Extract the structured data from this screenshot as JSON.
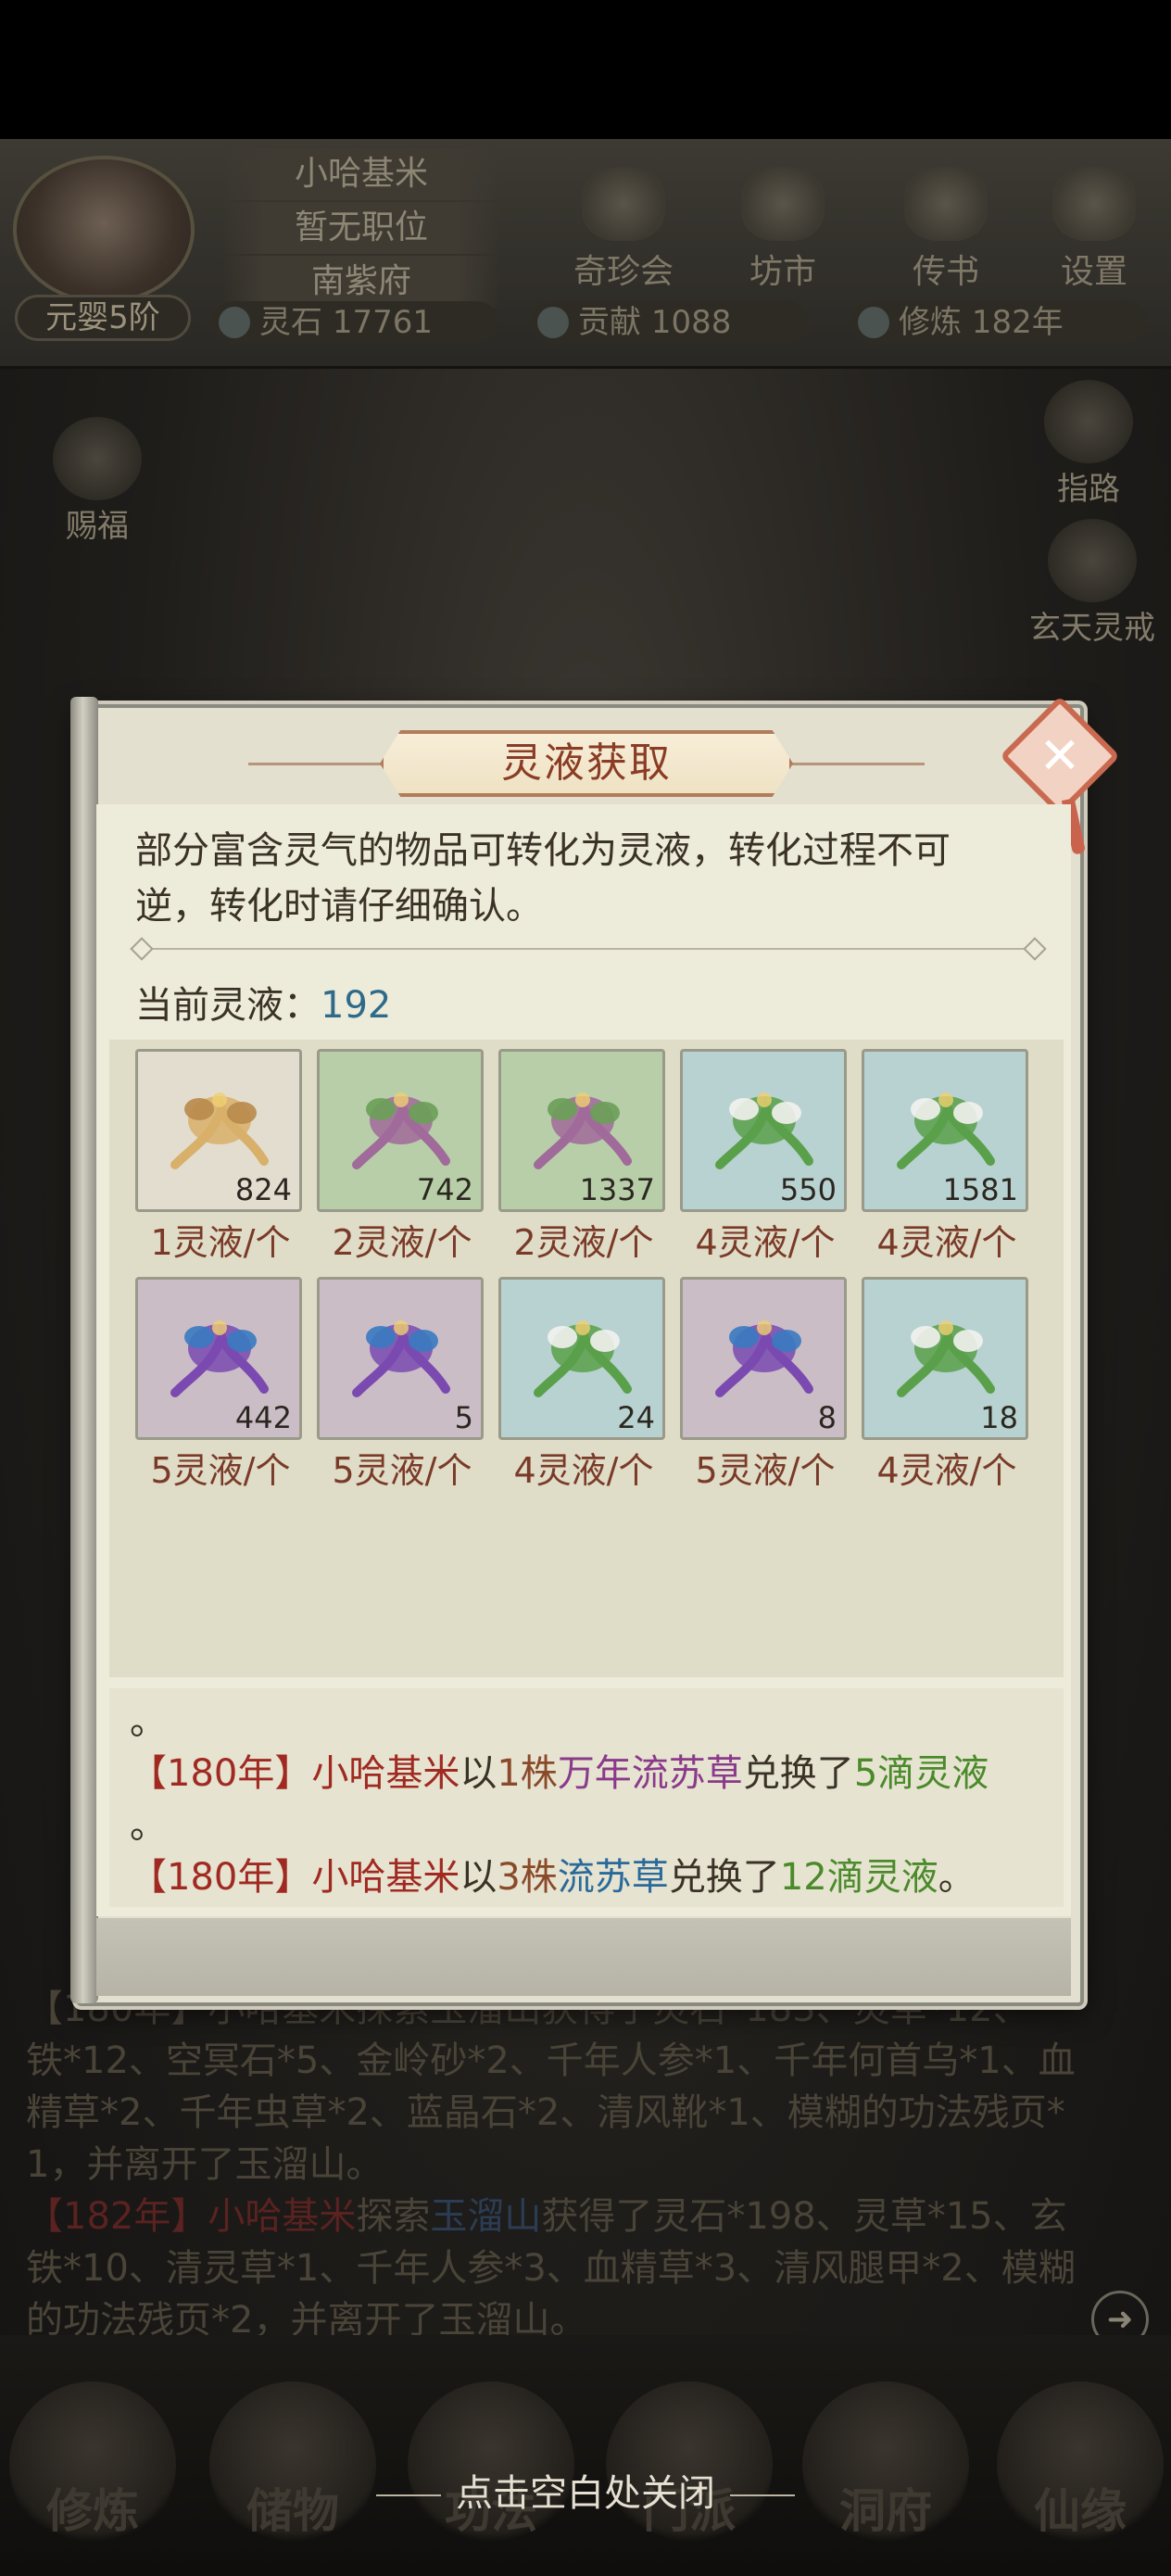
{
  "player": {
    "name": "小哈基米",
    "job": "暂无职位",
    "sect": "南紫府",
    "realm": "元婴5阶"
  },
  "top_buttons": [
    "奇珍会",
    "坊市",
    "传书",
    "设置"
  ],
  "resources": [
    {
      "label": "灵石",
      "value": "17761"
    },
    {
      "label": "贡献",
      "value": "1088"
    },
    {
      "label": "修炼",
      "value": "182年"
    }
  ],
  "side_icons": {
    "left": "赐福",
    "right_top": "指路",
    "right_bottom": "玄天灵戒"
  },
  "background_log": {
    "line1_prefix": "【180年】小哈基米探索玉溜山获得了灵石*183、灵草*12、",
    "line2": "铁*12、空冥石*5、金岭砂*2、千年人参*1、千年何首乌*1、血",
    "line3": "精草*2、千年虫草*2、蓝晶石*2、清风靴*1、模糊的功法残页*",
    "line4": "1，并离开了玉溜山。",
    "line5_year": "【182年】",
    "line5_name": "小哈基米",
    "line5_mid": "探索",
    "line5_place": "玉溜山",
    "line5_rest": "获得了灵石*198、灵草*15、玄",
    "line6": "铁*10、清灵草*1、千年人参*3、血精草*3、清风腿甲*2、模糊",
    "line7": "的功法残页*2，并离开了玉溜山。"
  },
  "bottom_nav": [
    "修炼",
    "储物",
    "功法",
    "门派",
    "洞府",
    "仙缘"
  ],
  "close_hint": "点击空白处关闭",
  "dialog": {
    "title": "灵液获取",
    "description_line1": "部分富含灵气的物品可转化为灵液，转化过程不可",
    "description_line2": "逆，转化时请仔细确认。",
    "current_label": "当前灵液：",
    "current_value": "192",
    "items": [
      {
        "count": "824",
        "rate": "1灵液/个",
        "rarity": "white",
        "icon": "ginseng-icon"
      },
      {
        "count": "742",
        "rate": "2灵液/个",
        "rarity": "green",
        "icon": "root-icon"
      },
      {
        "count": "1337",
        "rate": "2灵液/个",
        "rarity": "green",
        "icon": "cordyceps-icon"
      },
      {
        "count": "550",
        "rate": "4灵液/个",
        "rarity": "blue",
        "icon": "white-flower-icon"
      },
      {
        "count": "1581",
        "rate": "4灵液/个",
        "rarity": "blue",
        "icon": "red-bud-herb-icon"
      },
      {
        "count": "442",
        "rate": "5灵液/个",
        "rarity": "purple",
        "icon": "fruit-branch-icon"
      },
      {
        "count": "5",
        "rate": "5灵液/个",
        "rarity": "purple",
        "icon": "purple-lily-icon"
      },
      {
        "count": "24",
        "rate": "4灵液/个",
        "rarity": "blue",
        "icon": "violet-flower-icon"
      },
      {
        "count": "8",
        "rate": "5灵液/个",
        "rarity": "purple",
        "icon": "blue-lotus-icon"
      },
      {
        "count": "18",
        "rate": "4灵液/个",
        "rarity": "blue",
        "icon": "azure-lotus-icon"
      }
    ],
    "log": {
      "dot": "。",
      "entry1": {
        "year": "【180年】",
        "name": "小哈基米",
        "mid": "以",
        "qty": "1株",
        "herb": "万年流苏草",
        "verb": "兑换了",
        "result": "5滴灵液"
      },
      "entry1_tail": "。",
      "entry2": {
        "year": "【180年】",
        "name": "小哈基米",
        "mid": "以",
        "qty": "3株",
        "herb": "流苏草",
        "verb": "兑换了",
        "result": "12滴灵液",
        "end": "。"
      }
    }
  },
  "colors": {
    "accent_title": "#8a3c24",
    "value_blue": "#2e6a8a",
    "log_red": "#a02a22",
    "log_green": "#4a8a2a"
  }
}
